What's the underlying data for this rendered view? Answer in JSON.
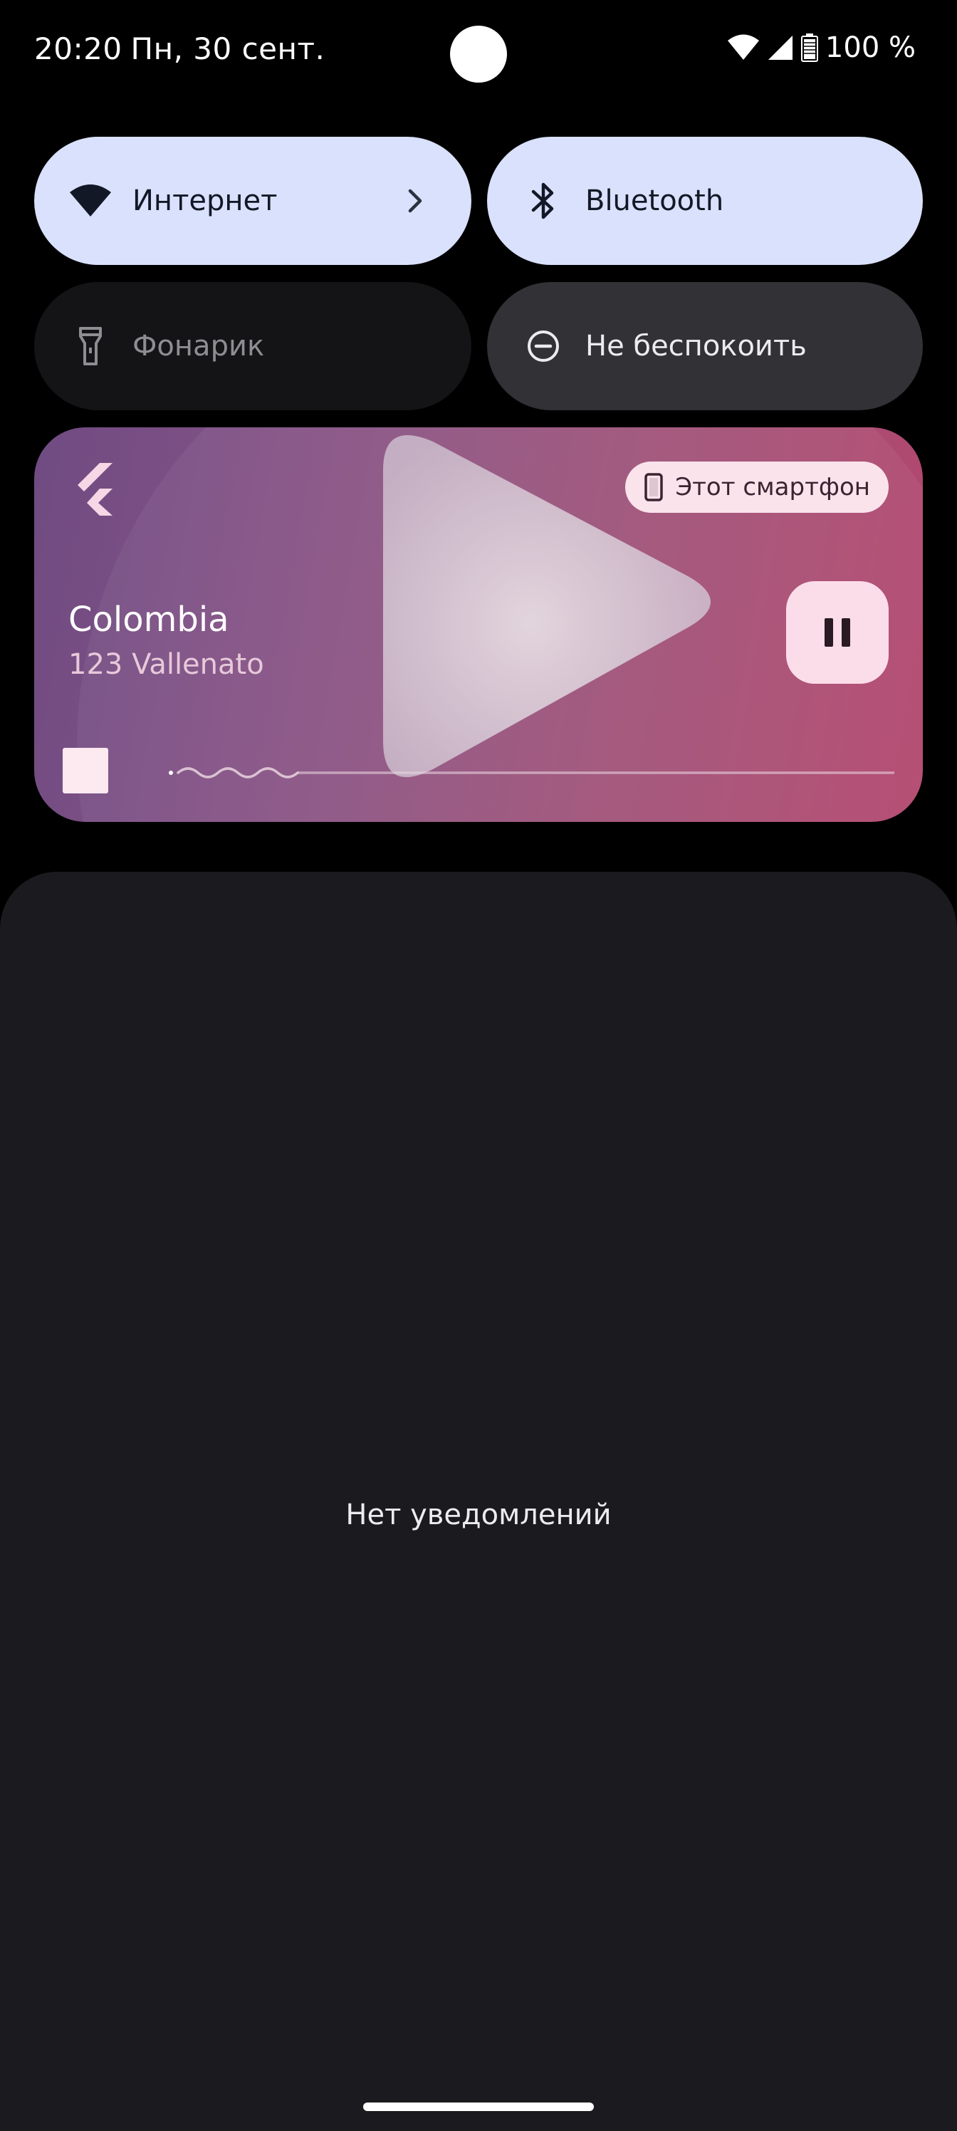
{
  "status_bar": {
    "time": "20:20",
    "date": "Пн, 30 сент.",
    "battery": "100 %",
    "icons": [
      "wifi-icon",
      "cell-signal-icon",
      "battery-icon"
    ]
  },
  "quick_settings": {
    "internet": {
      "label": "Интернет",
      "icon": "wifi-icon",
      "state": "on"
    },
    "bluetooth": {
      "label": "Bluetooth",
      "icon": "bluetooth-icon",
      "state": "on"
    },
    "flashlight": {
      "label": "Фонарик",
      "icon": "flashlight-icon",
      "state": "unavailable"
    },
    "dnd": {
      "label": "Не беспокоить",
      "icon": "do-not-disturb-icon",
      "state": "off"
    }
  },
  "media": {
    "app_icon": "flutter-logo-icon",
    "output_device": "Этот смартфон",
    "title": "Colombia",
    "artist": "123 Vallenato",
    "play_state": "playing",
    "progress": 0.0
  },
  "notifications": {
    "empty_text": "Нет уведомлений"
  },
  "colors": {
    "tile_active": "#d9e1fc",
    "tile_off": "#141416",
    "tile_dnd": "#313136",
    "shade": "#1b1b1f",
    "chip": "#fbe3ec"
  }
}
